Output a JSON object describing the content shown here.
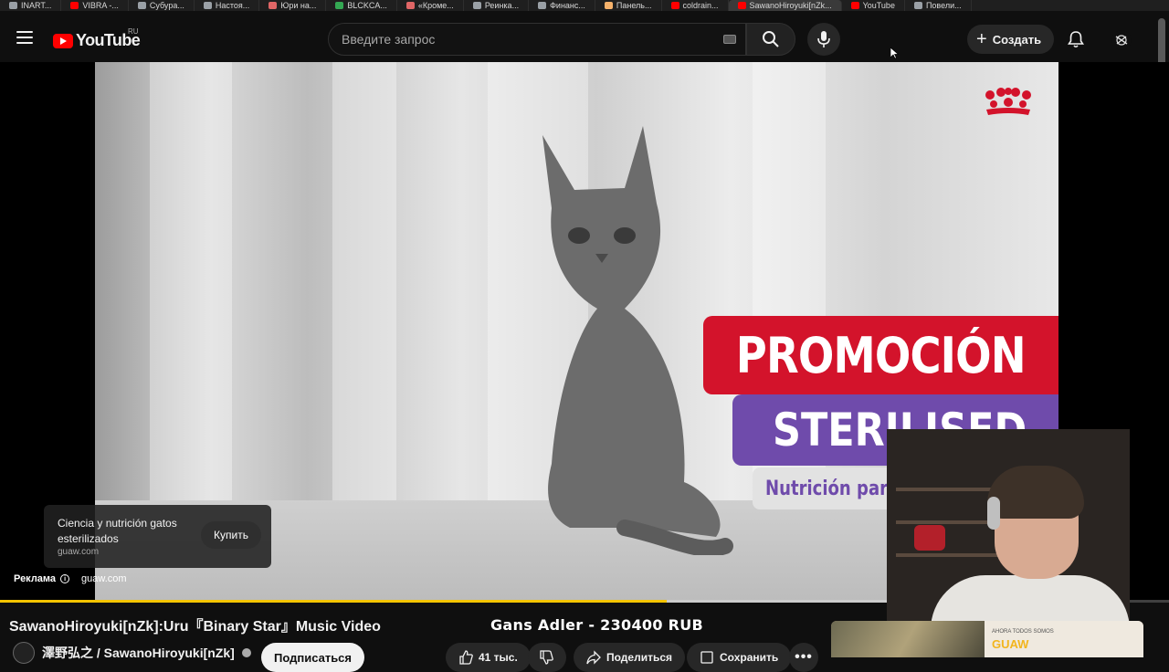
{
  "browser": {
    "tabs": [
      {
        "label": "INART...",
        "color": "#9aa0a6"
      },
      {
        "label": "VIBRA -...",
        "color": "#ff0000"
      },
      {
        "label": "Субура...",
        "color": "#9aa0a6"
      },
      {
        "label": "Настоя...",
        "color": "#9aa0a6"
      },
      {
        "label": "Юри на...",
        "color": "#e06666"
      },
      {
        "label": "BLCKCA...",
        "color": "#34a853"
      },
      {
        "label": "«Кроме...",
        "color": "#e06666"
      },
      {
        "label": "Реинка...",
        "color": "#9aa0a6"
      },
      {
        "label": "Финанс...",
        "color": "#9aa0a6"
      },
      {
        "label": "Панель...",
        "color": "#f6b26b"
      },
      {
        "label": "coldrain...",
        "color": "#ff0000"
      },
      {
        "label": "SawanoHiroyuki[nZk...",
        "color": "#ff0000",
        "active": true
      },
      {
        "label": "YouTube",
        "color": "#ff0000"
      },
      {
        "label": "Повели...",
        "color": "#9aa0a6"
      }
    ]
  },
  "header": {
    "logo_text": "YouTube",
    "region": "RU",
    "search_placeholder": "Введите запрос",
    "create_label": "Создать"
  },
  "ad_video": {
    "promo_line1": "PROMOCIÓN",
    "promo_line2": "STERILISED",
    "promo_line3": "Nutrición para t",
    "card_title": "Ciencia y nutrición gatos esterilizados",
    "card_domain": "guaw.com",
    "buy_label": "Купить",
    "ad_label": "Реклама",
    "ad_url": "guaw.com",
    "progress_fraction": 0.57
  },
  "stream_overlay": {
    "donation_text": "Gans Adler - 230400 RUB"
  },
  "video": {
    "title": "SawanoHiroyuki[nZk]:Uru『Binary Star』Music Video",
    "channel": "澤野弘之 / SawanoHiroyuki[nZk]",
    "subscribe_label": "Подписаться",
    "likes": "41 тыс.",
    "share_label": "Поделиться",
    "save_label": "Сохранить"
  },
  "side_ad": {
    "subtitle": "AHORA TODOS SOMOS",
    "brand": "GUAW"
  },
  "colors": {
    "brand_red": "#ff0000",
    "promo_red": "#d3132b",
    "promo_purple": "#6f4bab",
    "progress": "#f5c400"
  }
}
